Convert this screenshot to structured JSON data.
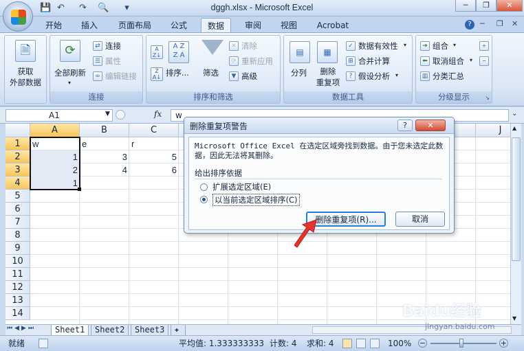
{
  "window": {
    "title": "dggh.xlsx - Microsoft Excel"
  },
  "tabs": [
    "开始",
    "插入",
    "页面布局",
    "公式",
    "数据",
    "审阅",
    "视图",
    "Acrobat"
  ],
  "ribbon": {
    "get_external": "获取\n外部数据",
    "refresh_all": "全部刷新",
    "connections": "连接",
    "properties": "属性",
    "edit_links": "编辑链接",
    "group_connections": "连接",
    "sort": "排序...",
    "filter": "筛选",
    "clear": "清除",
    "reapply": "重新应用",
    "advanced": "高级",
    "group_sort_filter": "排序和筛选",
    "text_to_columns": "分列",
    "remove_dup": "删除\n重复项",
    "data_validation": "数据有效性",
    "consolidate": "合并计算",
    "what_if": "假设分析",
    "group_data_tools": "数据工具",
    "group": "组合",
    "ungroup": "取消组合",
    "subtotal": "分类汇总",
    "group_outline": "分级显示"
  },
  "formula_bar": {
    "name_box": "A1",
    "fx": "fx",
    "value": "w"
  },
  "grid": {
    "columns": [
      "A",
      "B",
      "C",
      "D",
      "E",
      "F",
      "G",
      "H",
      "I",
      "J"
    ],
    "rows": [
      "1",
      "2",
      "3",
      "4",
      "5",
      "6",
      "7",
      "8",
      "9",
      "10",
      "11",
      "12",
      "13",
      "14"
    ],
    "cells": {
      "A1": "w",
      "B1": "e",
      "C1": "r",
      "A2": "1",
      "B2": "3",
      "C2": "5",
      "A3": "2",
      "B3": "4",
      "C3": "6",
      "A4": "1"
    }
  },
  "sheets": [
    "Sheet1",
    "Sheet2",
    "Sheet3"
  ],
  "status": {
    "ready": "就绪",
    "average": "平均值: 1.333333333",
    "count": "计数: 4",
    "sum": "求和: 4",
    "zoom": "100%"
  },
  "dialog": {
    "title": "删除重复项警告",
    "message": "Microsoft Office Excel 在选定区域旁找到数据。由于您未选定此数据，因此无法将其删除。",
    "section": "给出排序依据",
    "option1": "扩展选定区域(E)",
    "option2": "以当前选定区域排序(C)",
    "btn_remove": "删除重复项(R)...",
    "btn_cancel": "取消",
    "help": "?",
    "close": "✕"
  },
  "watermark": {
    "brand": "Baidu经验",
    "url": "jingyan.baidu.com"
  }
}
